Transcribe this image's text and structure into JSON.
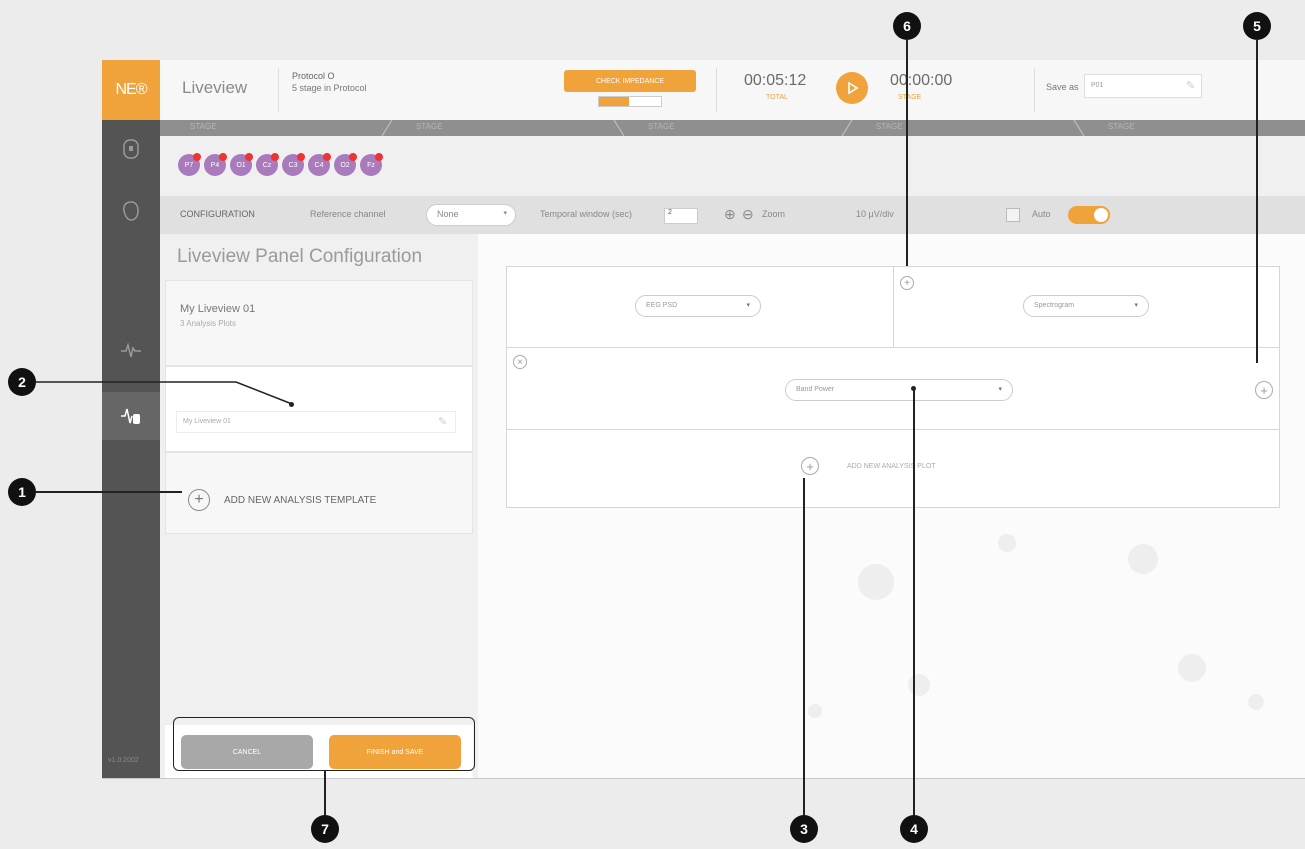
{
  "app": {
    "logo": "NE®",
    "title": "Liveview",
    "protocol_name": "Protocol O",
    "protocol_sub": "5 stage in Protocol",
    "check_button": "CHECK IMPEDANCE",
    "timer_elapsed": "00:05:12",
    "timer_elapsed_sub": "TOTAL",
    "timer_stage": "00:00:00",
    "timer_stage_sub": "STAGE",
    "save_as_label": "Save as",
    "save_as_value": "P01",
    "version": "v1.0.2002",
    "stages": [
      "STAGE",
      "STAGE",
      "STAGE",
      "STAGE",
      "STAGE"
    ]
  },
  "electrodes": [
    "P7",
    "P4",
    "O1",
    "Cz",
    "C3",
    "C4",
    "O2",
    "Fz"
  ],
  "config": {
    "label": "CONFIGURATION",
    "reference_label": "Reference channel",
    "reference_value": "None",
    "temporal_label": "Temporal window (sec)",
    "temporal_value": "2",
    "zoom_label": "Zoom",
    "scale": "10 µV/div",
    "auto_label": "Auto"
  },
  "panel": {
    "title": "Liveview Panel Configuration",
    "liveview_name": "My Liveview 01",
    "liveview_sub": "3 Analysis Plots",
    "template_name": "My Liveview 01",
    "add_template": "ADD NEW ANALYSIS TEMPLATE",
    "cancel": "CANCEL",
    "finish": "FINISH and SAVE"
  },
  "canvas": {
    "dd_eeg": "EEG PSD",
    "dd_spectrogram": "Spectrogram",
    "dd_band_power": "Band Power",
    "add_analysis": "ADD NEW ANALYSIS PLOT"
  },
  "callouts": [
    "1",
    "2",
    "3",
    "4",
    "5",
    "6",
    "7"
  ],
  "colors": {
    "accent": "#f0a23b",
    "rail": "#545454",
    "electrode": "#a97bbd",
    "electrode_alert": "#e33333"
  }
}
